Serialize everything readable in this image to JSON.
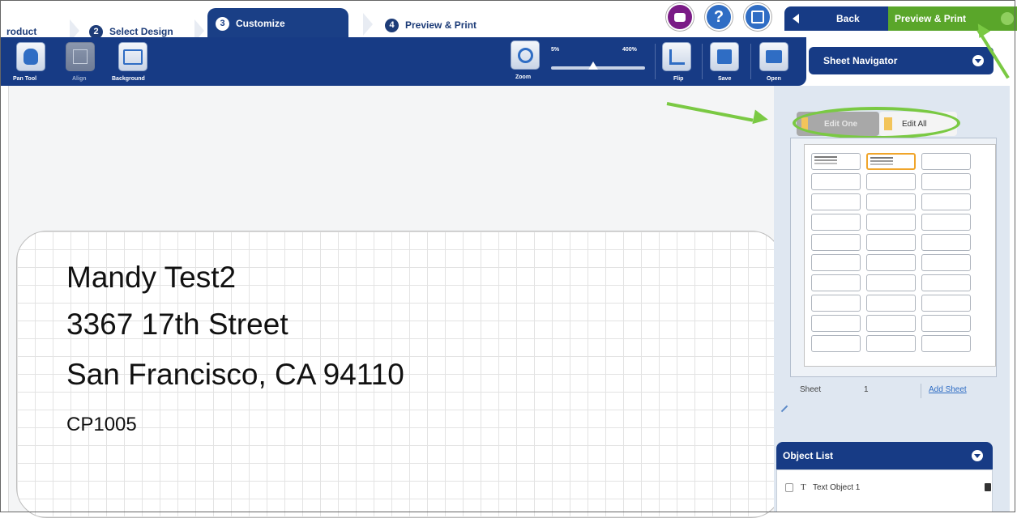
{
  "steps": {
    "step1_label": "roduct",
    "step2_num": "2",
    "step2_label": "Select Design",
    "step3_num": "3",
    "step3_label": "Customize",
    "step4_num": "4",
    "step4_label": "Preview & Print"
  },
  "header": {
    "back_label": "Back",
    "print_label": "Preview & Print",
    "help_glyph": "?"
  },
  "toolbar": {
    "pan_tool": "Pan Tool",
    "align": "Align",
    "background": "Background",
    "zoom": "Zoom",
    "zoom_min": "5%",
    "zoom_max": "400%",
    "flip": "Flip",
    "save": "Save",
    "open": "Open"
  },
  "zoom_level_fraction": 0.45,
  "canvas": {
    "line1": "Mandy Test2",
    "line2": "3367 17th Street",
    "line3": "San Francisco, CA 94110",
    "line4": "CP1005"
  },
  "sheet_navigator": {
    "title": "Sheet Navigator",
    "edit_one": "Edit One",
    "edit_all": "Edit All",
    "sheet_label": "Sheet",
    "sheet_number": "1",
    "add_sheet": "Add Sheet",
    "rows": 10,
    "cols": 3,
    "selected_cell": [
      0,
      1
    ]
  },
  "object_list": {
    "title": "Object List",
    "type_glyph": "T",
    "items": [
      {
        "label": "Text Object 1"
      }
    ]
  },
  "colors": {
    "navy": "#173b85",
    "green": "#5aa62a",
    "annotation_green": "#7ac943",
    "selected_cell": "#f0a52a"
  }
}
